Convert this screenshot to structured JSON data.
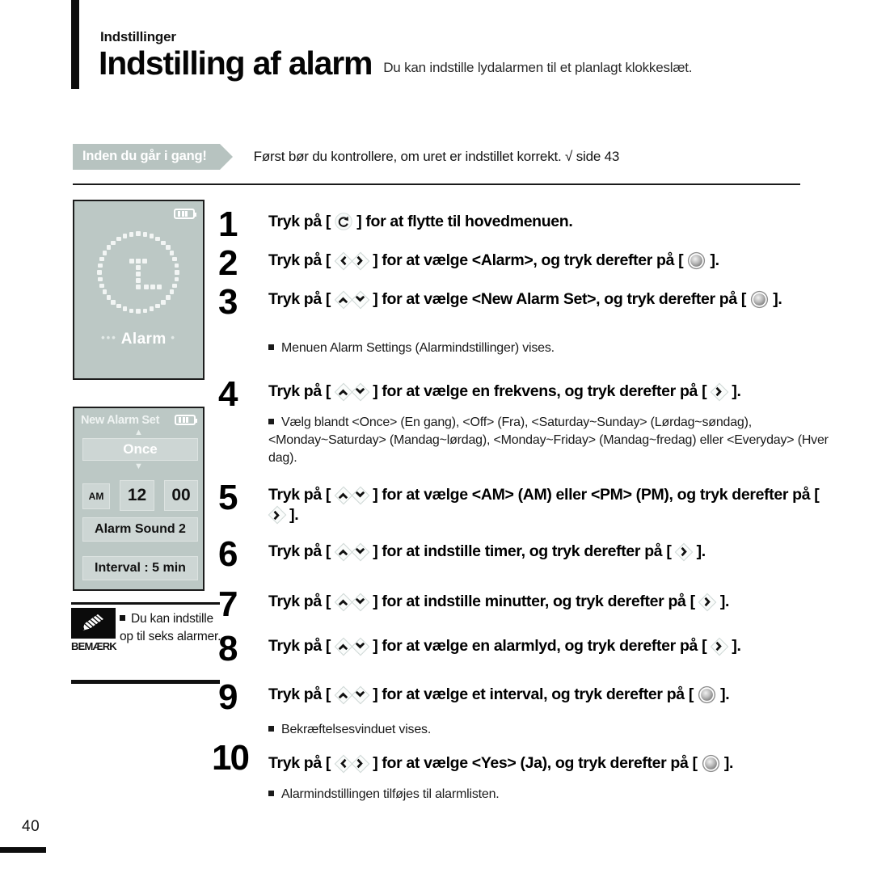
{
  "header": {
    "kicker": "Indstillinger",
    "title": "Indstilling af alarm",
    "subtitle": "Du kan indstille lydalarmen til et planlagt klokkeslæt."
  },
  "prep": {
    "tag": "Inden du går i gang!",
    "text": "Først bør du kontrollere, om uret er indstillet korrekt. √ side 43"
  },
  "screens": {
    "alarm": {
      "label": "Alarm",
      "dots_left": "•••",
      "dots_right": "•",
      "battery": "battery-icon"
    },
    "new_alarm_set": {
      "title": "New Alarm Set",
      "caret_up": "▲",
      "caret_down": "▼",
      "frequency": "Once",
      "ampm": "AM",
      "hour": "12",
      "minute": "00",
      "sound": "Alarm Sound 2",
      "interval": "Interval : 5 min",
      "battery": "battery-icon"
    }
  },
  "note": {
    "caption": "BEMÆRK",
    "icon": "pencil-icon",
    "text": "Du kan indstille op til seks alarmer."
  },
  "steps": [
    {
      "num": "1",
      "parts": [
        {
          "t": "text",
          "v": "Tryk på [ "
        },
        {
          "t": "icon",
          "v": "return-key-icon"
        },
        {
          "t": "text",
          "v": " ] for at flytte til hovedmenuen."
        }
      ]
    },
    {
      "num": "2",
      "parts": [
        {
          "t": "text",
          "v": "Tryk på [ "
        },
        {
          "t": "icon",
          "v": "left-key-icon"
        },
        {
          "t": "icon",
          "v": "right-key-icon"
        },
        {
          "t": "text",
          "v": " ] for at vælge <Alarm>, og tryk derefter på [ "
        },
        {
          "t": "icon",
          "v": "select-key-icon"
        },
        {
          "t": "text",
          "v": " ]."
        }
      ]
    },
    {
      "num": "3",
      "parts": [
        {
          "t": "text",
          "v": "Tryk på [ "
        },
        {
          "t": "icon",
          "v": "up-key-icon"
        },
        {
          "t": "icon",
          "v": "down-key-icon"
        },
        {
          "t": "text",
          "v": " ] for at vælge <New Alarm Set>, og tryk derefter på [ "
        },
        {
          "t": "icon",
          "v": "select-key-icon"
        },
        {
          "t": "text",
          "v": " ]."
        }
      ],
      "bullets": [
        "Menuen Alarm Settings (Alarmindstillinger) vises."
      ]
    },
    {
      "num": "4",
      "parts": [
        {
          "t": "text",
          "v": "Tryk på [ "
        },
        {
          "t": "icon",
          "v": "up-key-icon"
        },
        {
          "t": "icon",
          "v": "down-key-icon"
        },
        {
          "t": "text",
          "v": " ] for at vælge en frekvens, og tryk derefter på [ "
        },
        {
          "t": "icon",
          "v": "right-key-icon"
        },
        {
          "t": "text",
          "v": " ]."
        }
      ],
      "bullets": [
        "Vælg blandt <Once> (En gang), <Off> (Fra), <Saturday~Sunday> (Lørdag~søndag), <Monday~Saturday> (Mandag~lørdag), <Monday~Friday> (Mandag~fredag) eller <Everyday> (Hver dag)."
      ]
    },
    {
      "num": "5",
      "parts": [
        {
          "t": "text",
          "v": "Tryk på [ "
        },
        {
          "t": "icon",
          "v": "up-key-icon"
        },
        {
          "t": "icon",
          "v": "down-key-icon"
        },
        {
          "t": "text",
          "v": " ] for at vælge <AM> (AM) eller <PM> (PM), og tryk derefter på [ "
        },
        {
          "t": "icon",
          "v": "right-key-icon"
        },
        {
          "t": "text",
          "v": " ]."
        }
      ]
    },
    {
      "num": "6",
      "parts": [
        {
          "t": "text",
          "v": "Tryk på [ "
        },
        {
          "t": "icon",
          "v": "up-key-icon"
        },
        {
          "t": "icon",
          "v": "down-key-icon"
        },
        {
          "t": "text",
          "v": " ] for at indstille timer, og tryk derefter på [ "
        },
        {
          "t": "icon",
          "v": "right-key-icon"
        },
        {
          "t": "text",
          "v": " ]."
        }
      ]
    },
    {
      "num": "7",
      "parts": [
        {
          "t": "text",
          "v": "Tryk på [ "
        },
        {
          "t": "icon",
          "v": "up-key-icon"
        },
        {
          "t": "icon",
          "v": "down-key-icon"
        },
        {
          "t": "text",
          "v": " ] for at indstille minutter, og tryk derefter på [ "
        },
        {
          "t": "icon",
          "v": "right-key-icon"
        },
        {
          "t": "text",
          "v": " ]."
        }
      ]
    },
    {
      "num": "8",
      "parts": [
        {
          "t": "text",
          "v": "Tryk på [ "
        },
        {
          "t": "icon",
          "v": "up-key-icon"
        },
        {
          "t": "icon",
          "v": "down-key-icon"
        },
        {
          "t": "text",
          "v": " ] for at vælge en alarmlyd, og tryk derefter på [ "
        },
        {
          "t": "icon",
          "v": "right-key-icon"
        },
        {
          "t": "text",
          "v": " ]."
        }
      ]
    },
    {
      "num": "9",
      "parts": [
        {
          "t": "text",
          "v": "Tryk på [ "
        },
        {
          "t": "icon",
          "v": "up-key-icon"
        },
        {
          "t": "icon",
          "v": "down-key-icon"
        },
        {
          "t": "text",
          "v": " ] for at vælge et interval, og tryk derefter på [ "
        },
        {
          "t": "icon",
          "v": "select-key-icon"
        },
        {
          "t": "text",
          "v": " ]."
        }
      ],
      "bullets": [
        "Bekræftelsesvinduet vises."
      ]
    },
    {
      "num": "10",
      "parts": [
        {
          "t": "text",
          "v": "Tryk på [ "
        },
        {
          "t": "icon",
          "v": "left-key-icon"
        },
        {
          "t": "icon",
          "v": "right-key-icon"
        },
        {
          "t": "text",
          "v": " ] for at vælge <Yes> (Ja), og tryk derefter på [ "
        },
        {
          "t": "icon",
          "v": "select-key-icon"
        },
        {
          "t": "text",
          "v": " ]."
        }
      ],
      "bullets": [
        "Alarmindstillingen tilføjes til alarmlisten."
      ]
    }
  ],
  "footer": {
    "page_number": "40"
  },
  "colors": {
    "screen_bg": "#bcc8c5",
    "tag_bg": "#b7c3c0",
    "cell_bg": "#cdd6d4",
    "ink": "#111111"
  }
}
